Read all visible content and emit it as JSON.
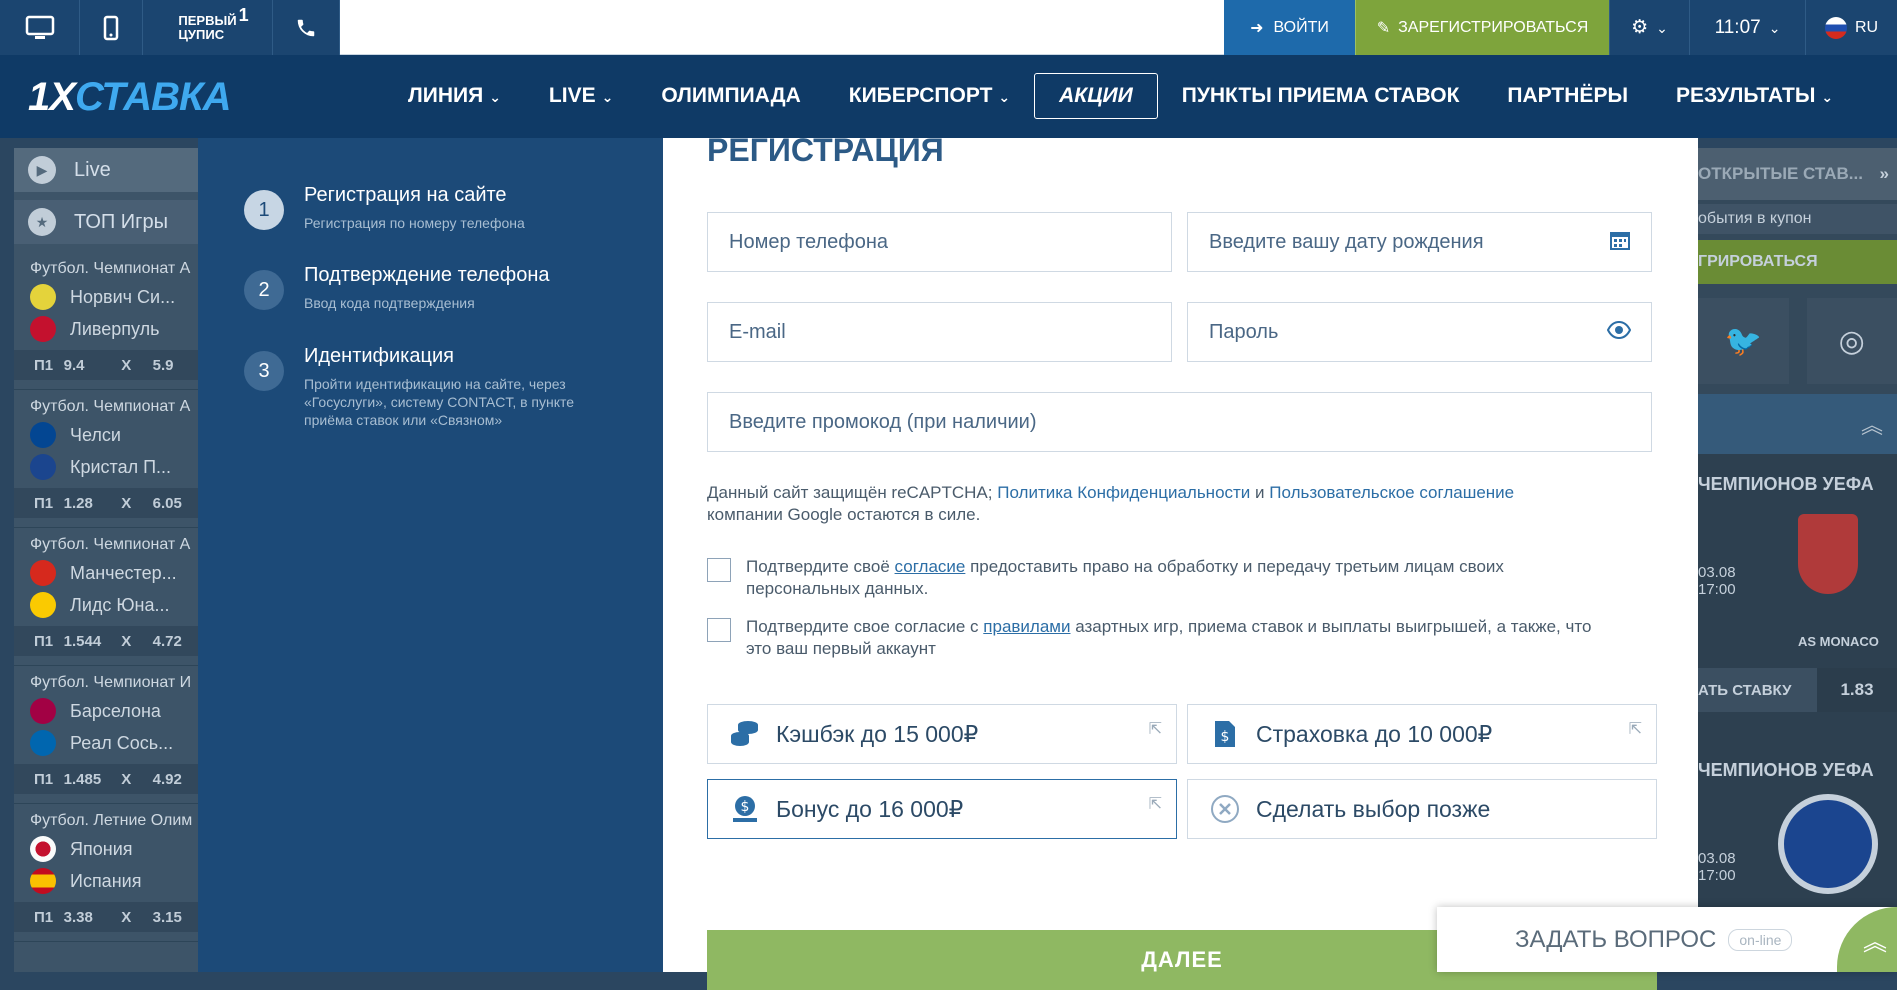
{
  "topbar": {
    "cupis_label_1": "ПЕРВЫЙ",
    "cupis_label_2": "ЦУПИС",
    "cupis_num": "1",
    "login_label": "ВОЙТИ",
    "register_label": "ЗАРЕГИСТРИРОВАТЬСЯ",
    "time": "11:07",
    "lang": "RU"
  },
  "nav": {
    "logo_a": "1X",
    "logo_b": "СТАВКА",
    "items": [
      "ЛИНИЯ",
      "LIVE",
      "ОЛИМПИАДА",
      "КИБЕРСПОРТ",
      "АКЦИИ",
      "ПУНКТЫ ПРИЕМА СТАВОК",
      "ПАРТНЁРЫ",
      "РЕЗУЛЬТАТЫ"
    ]
  },
  "left": {
    "live": "Live",
    "top": "ТОП Игры",
    "matches": [
      {
        "league": "Футбол. Чемпионат А",
        "t1": "Норвич Си...",
        "t2": "Ливерпуль",
        "p1": "П1",
        "o1": "9.4",
        "x": "X",
        "ox": "5.9"
      },
      {
        "league": "Футбол. Чемпионат А",
        "t1": "Челси",
        "t2": "Кристал П...",
        "p1": "П1",
        "o1": "1.28",
        "x": "X",
        "ox": "6.05"
      },
      {
        "league": "Футбол. Чемпионат А",
        "t1": "Манчестер...",
        "t2": "Лидс Юна...",
        "p1": "П1",
        "o1": "1.544",
        "x": "X",
        "ox": "4.72"
      },
      {
        "league": "Футбол. Чемпионат И",
        "t1": "Барселона",
        "t2": "Реал Сось...",
        "p1": "П1",
        "o1": "1.485",
        "x": "X",
        "ox": "4.92"
      },
      {
        "league": "Футбол. Летние Олим",
        "t1": "Япония",
        "t2": "Испания",
        "p1": "П1",
        "o1": "3.38",
        "x": "X",
        "ox": "3.15"
      }
    ]
  },
  "right": {
    "tab": "ОТКРЫТЫЕ СТАВ...",
    "coupon": "обытия в купон",
    "reg": "ГРИРОВАТЬСЯ",
    "card1_title": "ЧЕМПИОНОВ УЕФА",
    "card1_date": "03.08",
    "card1_time": "17:00",
    "card1_team": "AS MONACO",
    "card1_bet": "АТЬ СТАВКУ",
    "card1_odd": "1.83",
    "card2_title": "ЧЕМПИОНОВ УЕФА",
    "card2_date": "03.08",
    "card2_time": "17:00"
  },
  "steps": [
    {
      "num": "1",
      "title": "Регистрация на сайте",
      "sub": "Регистрация по номеру телефона"
    },
    {
      "num": "2",
      "title": "Подтверждение телефона",
      "sub": "Ввод кода подтверждения"
    },
    {
      "num": "3",
      "title": "Идентификация",
      "sub": "Пройти идентификацию на сайте, через «Госуслуги», систему CONTACT, в пункте приёма ставок или «Связном»"
    }
  ],
  "form": {
    "title": "РЕГИСТРАЦИЯ",
    "phone_ph": "Номер телефона",
    "birth_ph": "Введите вашу дату рождения",
    "email_ph": "E-mail",
    "password_ph": "Пароль",
    "promo_ph": "Введите промокод (при наличии)",
    "note_1": "Данный сайт защищён reCAPTCHA;",
    "note_link1": "Политика Конфиденциальности",
    "note_and": "и",
    "note_link2": "Пользовательское соглашение",
    "note_2": "компании Google остаются в силе.",
    "chk1_a": "Подтвердите своё",
    "chk1_link": "согласие",
    "chk1_b": "предоставить право на обработку и передачу третьим лицам своих персональных данных.",
    "chk2_a": "Подтвердите свое согласие с",
    "chk2_link": "правилами",
    "chk2_b": "азартных игр, приема ставок и выплаты выигрышей, а также, что это ваш первый аккаунт",
    "bonus_cashback": "Кэшбэк до 15 000₽",
    "bonus_insurance": "Страховка до 10 000₽",
    "bonus_bonus": "Бонус до 16 000₽",
    "bonus_later": "Сделать выбор позже",
    "next": "ДАЛЕЕ"
  },
  "ask": {
    "label": "ЗАДАТЬ ВОПРОС",
    "status": "on-line"
  }
}
